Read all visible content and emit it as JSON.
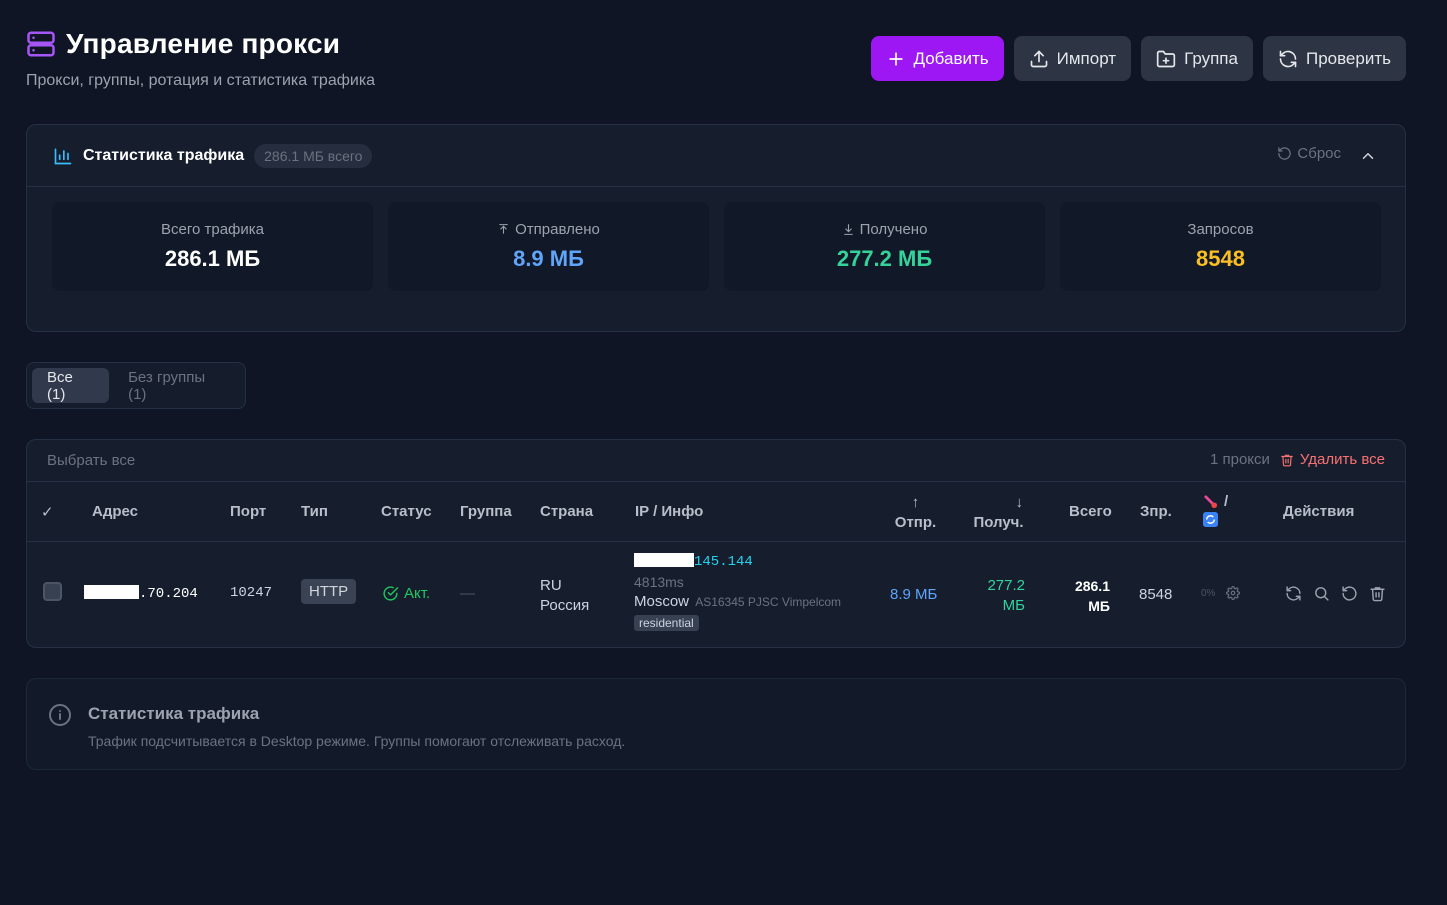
{
  "header": {
    "title": "Управление прокси",
    "subtitle": "Прокси, группы, ротация и статистика трафика",
    "icon": "server-icon",
    "accent": "#a855f7"
  },
  "toolbar": {
    "add_label": "Добавить",
    "import_label": "Импорт",
    "group_label": "Группа",
    "check_label": "Проверить"
  },
  "traffic": {
    "title": "Статистика трафика",
    "total_badge": "286.1 МБ всего",
    "reset_label": "Сброс",
    "boxes": [
      {
        "label": "Всего трафика",
        "value": "286.1 МБ",
        "color": "#ffffff"
      },
      {
        "label": "Отправлено",
        "value": "8.9 МБ",
        "color": "#60a5fa",
        "icon": "upload-icon"
      },
      {
        "label": "Получено",
        "value": "277.2 МБ",
        "color": "#34d399",
        "icon": "download-icon"
      },
      {
        "label": "Запросов",
        "value": "8548",
        "color": "#fbbf24"
      }
    ]
  },
  "tabs": [
    {
      "label": "Все (1)",
      "active": true
    },
    {
      "label": "Без группы (1)",
      "active": false
    }
  ],
  "table": {
    "select_all_label": "Выбрать все",
    "proxy_count": "1 прокси",
    "delete_all_label": "Удалить все",
    "columns": {
      "check": "✓",
      "address": "Адрес",
      "port": "Порт",
      "type": "Тип",
      "status": "Статус",
      "group": "Группа",
      "country": "Страна",
      "ip_info": "IP / Инфо",
      "sent_arrow": "↑",
      "sent": "Отпр.",
      "recv_arrow": "↓",
      "recv": "Получ.",
      "total": "Всего",
      "requests": "Зпр.",
      "rotation_sep": "/",
      "actions": "Действия"
    },
    "rows": [
      {
        "address_suffix": ".70.204",
        "port": "10247",
        "type": "HTTP",
        "status": "Акт.",
        "group": "—",
        "country_code": "RU",
        "country_name": "Россия",
        "ip_suffix": "145.144",
        "latency": "4813ms",
        "city": "Moscow",
        "asn": "AS16345 PJSC Vimpelcom",
        "ip_tag": "residential",
        "sent": "8.9 МБ",
        "recv_value": "277.2",
        "recv_unit": "МБ",
        "total_value": "286.1",
        "total_unit": "МБ",
        "requests": "8548",
        "rotation": "0%"
      }
    ]
  },
  "info": {
    "title": "Статистика трафика",
    "text": "Трафик подсчитывается в Desktop режиме. Группы помогают отслеживать расход."
  }
}
